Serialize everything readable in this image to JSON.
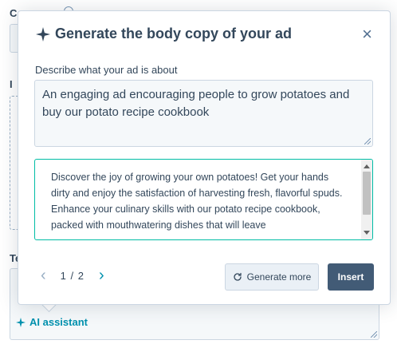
{
  "background_form": {
    "label_1": "C",
    "label_2": "I",
    "label_3": "Te",
    "ai_assistant_label": "AI assistant"
  },
  "popover": {
    "title": "Generate the body copy of your ad",
    "close_glyph": "×",
    "prompt_label": "Describe what your ad is about",
    "prompt_value": "An engaging ad encouraging people to grow potatoes and buy our potato recipe cookbook",
    "result_text": "Discover the joy of growing your own potatoes! Get your hands dirty and enjoy the satisfaction of harvesting fresh, flavorful spuds. Enhance your culinary skills with our potato recipe cookbook, packed with mouthwatering dishes that will leave",
    "pagination": {
      "prev_glyph": "‹",
      "next_glyph": "›",
      "current": "1 / 2"
    },
    "generate_more_label": "Generate more",
    "insert_label": "Insert"
  },
  "colors": {
    "accent": "#0091ae",
    "primary_button": "#425b76",
    "result_border": "#00bda5",
    "text": "#33475b"
  },
  "icons": [
    "sparkle-icon",
    "close-icon",
    "refresh-icon",
    "chevron-left-icon",
    "chevron-right-icon"
  ]
}
